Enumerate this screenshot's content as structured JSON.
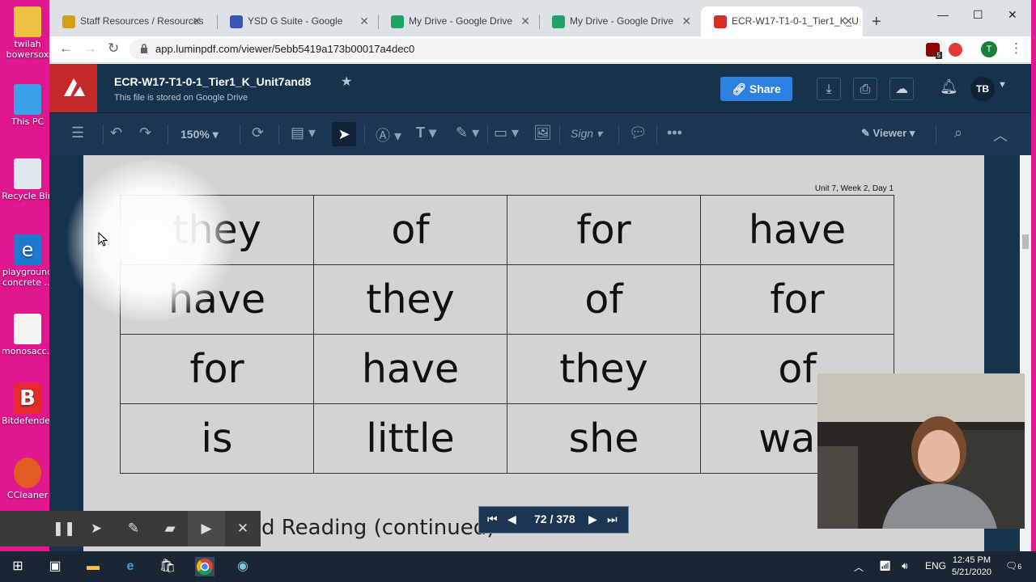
{
  "desktop": {
    "icons": [
      {
        "label": "twilah bowersox",
        "color": "#f0c040"
      },
      {
        "label": "This PC",
        "color": "#3aa0e8"
      },
      {
        "label": "Recycle Bin",
        "color": "#dfe8ef"
      },
      {
        "label": "playground concrete ...",
        "color": "#1e78d0"
      },
      {
        "label": "monosacc...",
        "color": "#f5f5f5"
      },
      {
        "label": "Bitdefender",
        "color": "#e52a2a"
      },
      {
        "label": "CCleaner",
        "color": "#e25b22"
      }
    ]
  },
  "browser": {
    "tabs": [
      {
        "title": "Staff Resources / Resources",
        "fav_color": "#d4a017"
      },
      {
        "title": "YSD G Suite - Google",
        "fav_color": "#3a55b4"
      },
      {
        "title": "My Drive - Google Drive",
        "fav_color": "#1fa463"
      },
      {
        "title": "My Drive - Google Drive",
        "fav_color": "#1fa463"
      },
      {
        "title": "ECR-W17-T1-0-1_Tier1_K_U",
        "fav_color": "#d93025"
      }
    ],
    "url": "app.luminpdf.com/viewer/5ebb5419a173b00017a4dec0",
    "profile_initial": "T",
    "extension_badge": "5"
  },
  "lumin": {
    "doc_title": "ECR-W17-T1-0-1_Tier1_K_Unit7and8",
    "doc_subtitle": "This file is stored on Google Drive",
    "share_label": "Share",
    "avatar_initials": "TB",
    "zoom": "150%",
    "mode_label": "Viewer",
    "sign_label": "Sign",
    "page_indicator": "72 / 378"
  },
  "document": {
    "tag": "Unit 7, Week 2, Day 1",
    "rows": [
      [
        "they",
        "of",
        "for",
        "have"
      ],
      [
        "have",
        "they",
        "of",
        "for"
      ],
      [
        "for",
        "have",
        "they",
        "of"
      ],
      [
        "is",
        "little",
        "she",
        "was"
      ]
    ],
    "continued_text": "d Reading (continued)"
  },
  "taskbar": {
    "language": "ENG",
    "time": "12:45 PM",
    "date": "5/21/2020",
    "notification_count": "6"
  }
}
